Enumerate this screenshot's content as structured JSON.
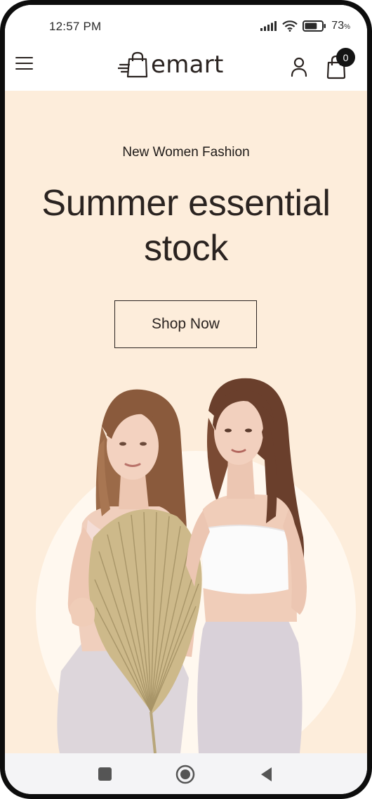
{
  "status_bar": {
    "time": "12:57 PM",
    "battery_percent": "73",
    "battery_unit": "%",
    "battery_level": 0.73
  },
  "header": {
    "brand_name": "emart",
    "cart_count": "0",
    "icons": [
      "menu-icon",
      "logo-bag-icon",
      "user-icon",
      "cart-bag-icon"
    ]
  },
  "hero": {
    "subtitle": "New Women Fashion",
    "title_line1": "Summer essential",
    "title_line2": "stock",
    "cta_label": "Shop Now",
    "background_color": "#fdeddb",
    "image_description_icon": "two-models-image"
  },
  "nav_bar": {
    "icons": [
      "recents-square-icon",
      "home-circle-icon",
      "back-triangle-icon"
    ]
  },
  "colors": {
    "text_dark": "#2a2320",
    "badge": "#141414",
    "hero_bg": "#fdeddb"
  }
}
